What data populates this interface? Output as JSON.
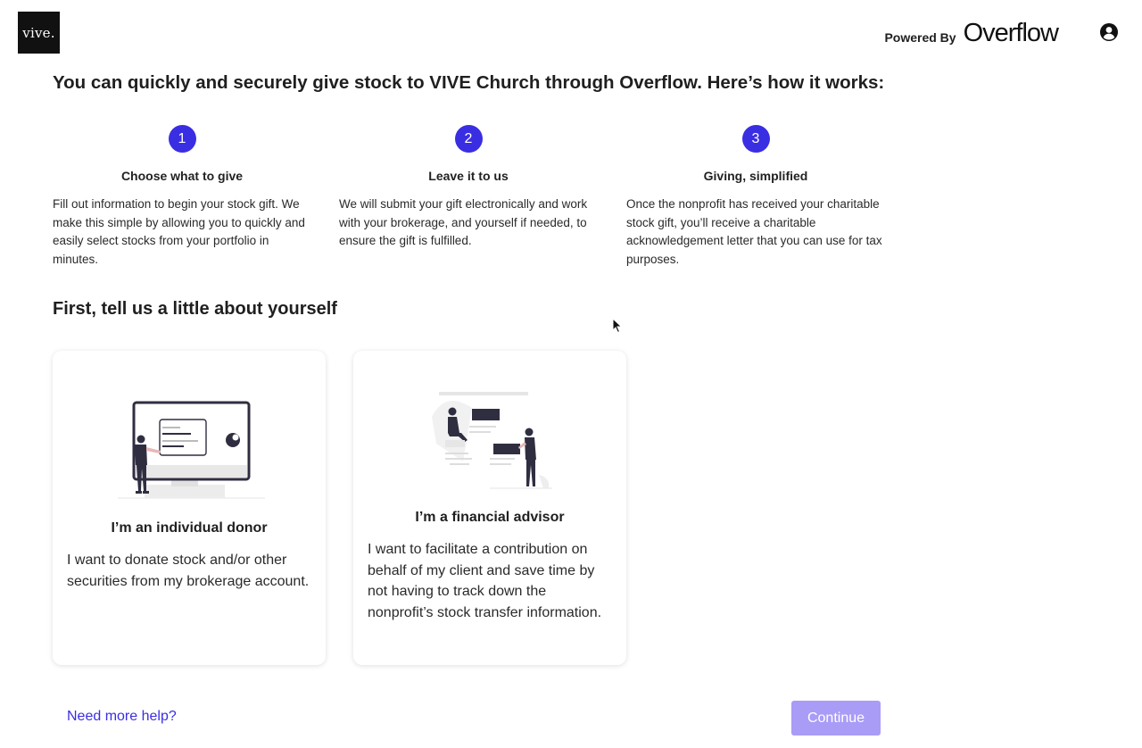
{
  "header": {
    "logo_text": "vive.",
    "powered_label": "Powered By",
    "powered_brand": "Overflow",
    "account_icon": "user-circle-icon"
  },
  "intro": {
    "headline": "You can quickly and securely give stock to VIVE Church through Overflow. Here’s how it works:"
  },
  "steps": [
    {
      "number": "1",
      "title": "Choose what to give",
      "description": "Fill out information to begin your stock gift. We make this simple by allowing you to quickly and easily select stocks from your portfolio in minutes."
    },
    {
      "number": "2",
      "title": "Leave it to us",
      "description": "We will submit your gift electronically and work with your brokerage, and yourself if needed, to ensure the gift is fulfilled."
    },
    {
      "number": "3",
      "title": "Giving, simplified",
      "description": "Once the nonprofit has received your charitable stock gift, you’ll receive a charitable acknowledgement letter that you can use for tax purposes."
    }
  ],
  "about": {
    "title": "First, tell us a little about yourself",
    "options": [
      {
        "title": "I’m an individual donor",
        "description": "I want to donate stock and/or other securities from my brokerage account.",
        "illustration": "person-at-monitor-illustration"
      },
      {
        "title": "I’m a financial advisor",
        "description": "I want to facilitate a contribution on behalf of my client and save time by not having to track down the nonprofit’s stock transfer information.",
        "illustration": "advisor-and-client-illustration"
      }
    ]
  },
  "footer": {
    "help_link": "Need more help?",
    "continue_label": "Continue"
  },
  "colors": {
    "accent": "#3a2ee3",
    "continue_disabled": "#a99cf6",
    "logo_bg": "#111111"
  }
}
